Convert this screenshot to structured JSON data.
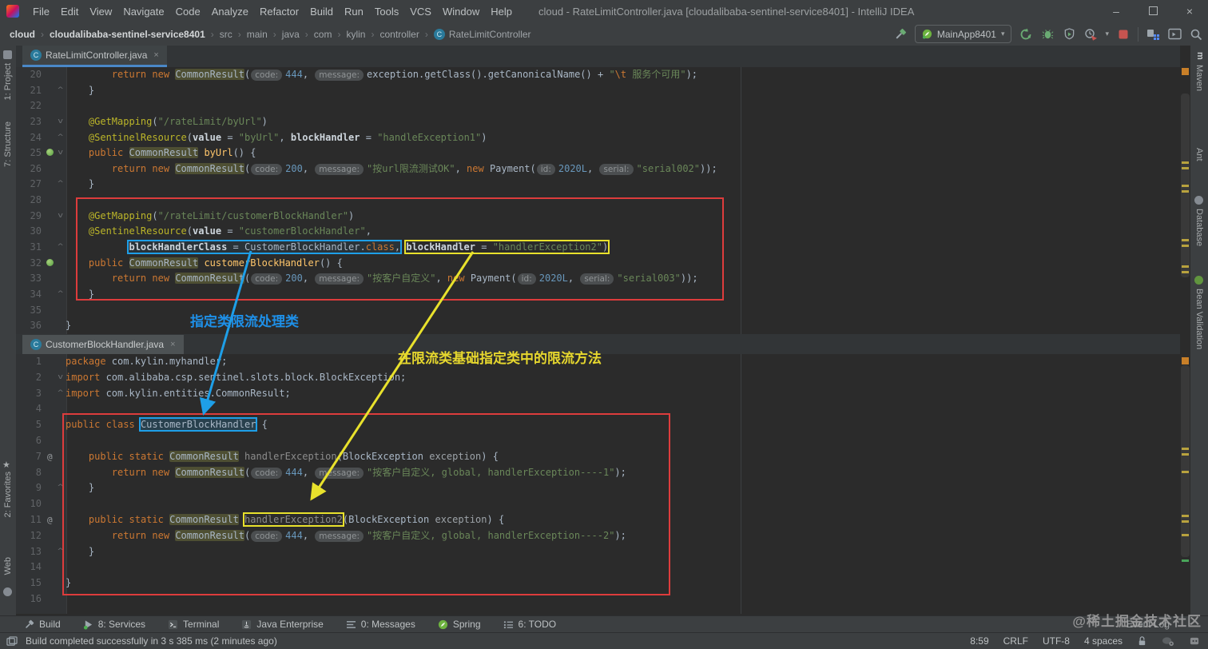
{
  "title_bar": {
    "menus": [
      "File",
      "Edit",
      "View",
      "Navigate",
      "Code",
      "Analyze",
      "Refactor",
      "Build",
      "Run",
      "Tools",
      "VCS",
      "Window",
      "Help"
    ],
    "title": "cloud - RateLimitController.java [cloudalibaba-sentinel-service8401] - IntelliJ IDEA",
    "controls": {
      "minimize": "–",
      "close": "×"
    }
  },
  "ui": {
    "close_glyph": "×",
    "crumb_separator": "›",
    "caret_down": "▾",
    "class_icon_letter": "C"
  },
  "toolbar": {
    "breadcrumbs": [
      {
        "label": "cloud",
        "bold": true
      },
      {
        "label": "cloudalibaba-sentinel-service8401",
        "bold": true
      },
      {
        "label": "src",
        "bold": false
      },
      {
        "label": "main",
        "bold": false
      },
      {
        "label": "java",
        "bold": false
      },
      {
        "label": "com",
        "bold": false
      },
      {
        "label": "kylin",
        "bold": false
      },
      {
        "label": "controller",
        "bold": false
      },
      {
        "label": "RateLimitController",
        "bold": false
      }
    ],
    "run_config": "MainApp8401"
  },
  "left_bar": {
    "items": [
      "1: Project",
      "7: Structure",
      "2: Favorites",
      "Web"
    ]
  },
  "right_bar": {
    "items": [
      "Maven",
      "Ant",
      "Database",
      "Bean Validation"
    ]
  },
  "overlay_notes": {
    "blue": "指定类限流处理类",
    "yellow": "在限流类基础指定类中的限流方法"
  },
  "colors": {
    "editor_bg": "#2b2b2b",
    "chrome_bg": "#3c3f41",
    "red_box": "#dd3c3c",
    "blue_annotation": "#1e9fe8",
    "yellow_annotation": "#e8e12c",
    "tab_underline": "#4a88c7",
    "keyword": "#cc7832",
    "string": "#6a8759",
    "number": "#6897bb"
  },
  "editors": [
    {
      "tab": "RateLimitController.java",
      "lines": [
        {
          "n": 20,
          "s": [
            [
              "def",
              "        "
            ],
            [
              "kw",
              "return"
            ],
            [
              "def",
              " "
            ],
            [
              "kw",
              "new"
            ],
            [
              "def",
              " "
            ],
            [
              "hl",
              "CommonResult"
            ],
            [
              "def",
              "("
            ],
            [
              "hint",
              "code:"
            ],
            [
              "num",
              "444"
            ],
            [
              "def",
              ", "
            ],
            [
              "hint",
              "message:"
            ],
            [
              "def",
              "exception.getClass().getCanonicalName() + "
            ],
            [
              "str",
              "\""
            ],
            [
              "esc",
              "\\t"
            ],
            [
              "str",
              " 服务个可用\""
            ],
            [
              "def",
              ");"
            ]
          ]
        },
        {
          "n": 21,
          "ic": [
            "up"
          ],
          "s": [
            [
              "def",
              "    }"
            ]
          ]
        },
        {
          "n": 22,
          "s": []
        },
        {
          "n": 23,
          "ic": [
            "down"
          ],
          "s": [
            [
              "def",
              "    "
            ],
            [
              "ann",
              "@GetMapping"
            ],
            [
              "def",
              "("
            ],
            [
              "str",
              "\"/rateLimit/byUrl\""
            ],
            [
              "def",
              ")"
            ]
          ]
        },
        {
          "n": 24,
          "ic": [
            "up"
          ],
          "s": [
            [
              "def",
              "    "
            ],
            [
              "ann",
              "@SentinelResource"
            ],
            [
              "def",
              "("
            ],
            [
              "atr",
              "value"
            ],
            [
              "def",
              " = "
            ],
            [
              "str",
              "\"byUrl\""
            ],
            [
              "def",
              ", "
            ],
            [
              "atr",
              "blockHandler"
            ],
            [
              "def",
              " = "
            ],
            [
              "str",
              "\"handleException1\""
            ],
            [
              "def",
              ")"
            ]
          ]
        },
        {
          "n": 25,
          "ic": [
            "bean",
            "down"
          ],
          "s": [
            [
              "def",
              "    "
            ],
            [
              "kw",
              "public"
            ],
            [
              "def",
              " "
            ],
            [
              "hl",
              "CommonResult"
            ],
            [
              "def",
              " "
            ],
            [
              "mth",
              "byUrl"
            ],
            [
              "def",
              "() {"
            ]
          ]
        },
        {
          "n": 26,
          "s": [
            [
              "def",
              "        "
            ],
            [
              "kw",
              "return"
            ],
            [
              "def",
              " "
            ],
            [
              "kw",
              "new"
            ],
            [
              "def",
              " "
            ],
            [
              "hl",
              "CommonResult"
            ],
            [
              "def",
              "("
            ],
            [
              "hint",
              "code:"
            ],
            [
              "num",
              "200"
            ],
            [
              "def",
              ", "
            ],
            [
              "hint",
              "message:"
            ],
            [
              "str",
              "\"按url限流测试OK\""
            ],
            [
              "def",
              ", "
            ],
            [
              "kw",
              "new"
            ],
            [
              "def",
              " Payment("
            ],
            [
              "hint",
              "id:"
            ],
            [
              "num",
              "2020L"
            ],
            [
              "def",
              ", "
            ],
            [
              "hint",
              "serial:"
            ],
            [
              "str",
              "\"serial002\""
            ],
            [
              "def",
              "));"
            ]
          ]
        },
        {
          "n": 27,
          "ic": [
            "up"
          ],
          "s": [
            [
              "def",
              "    }"
            ]
          ]
        },
        {
          "n": 28,
          "s": []
        },
        {
          "n": 29,
          "ic": [
            "down"
          ],
          "s": [
            [
              "def",
              "    "
            ],
            [
              "ann",
              "@GetMapping"
            ],
            [
              "def",
              "("
            ],
            [
              "str",
              "\"/rateLimit/customerBlockHandler\""
            ],
            [
              "def",
              ")"
            ]
          ]
        },
        {
          "n": 30,
          "s": [
            [
              "def",
              "    "
            ],
            [
              "ann",
              "@SentinelResource"
            ],
            [
              "def",
              "("
            ],
            [
              "atr",
              "value"
            ],
            [
              "def",
              " = "
            ],
            [
              "str",
              "\"customerBlockHandler\""
            ],
            [
              "def",
              ","
            ]
          ]
        },
        {
          "n": 31,
          "ic": [
            "up"
          ],
          "s": [
            [
              "def",
              "           "
            ],
            [
              "box",
              "blue",
              [
                [
                  "atr",
                  "blockHandlerClass"
                ],
                [
                  "def",
                  " = "
                ],
                [
                  "def",
                  "CustomerBlockHandler."
                ],
                [
                  "kw",
                  "class"
                ],
                [
                  "def",
                  ","
                ]
              ]
            ],
            [
              "def",
              " "
            ],
            [
              "box",
              "yellow",
              [
                [
                  "atr",
                  "blockHandler"
                ],
                [
                  "def",
                  " = "
                ],
                [
                  "str",
                  "\"handlerException2\""
                ],
                [
                  "def",
                  ")"
                ]
              ]
            ]
          ]
        },
        {
          "n": 32,
          "ic": [
            "bean"
          ],
          "s": [
            [
              "def",
              "    "
            ],
            [
              "kw",
              "public"
            ],
            [
              "def",
              " "
            ],
            [
              "hl",
              "CommonResult"
            ],
            [
              "def",
              " "
            ],
            [
              "mth",
              "customerBlockHandler"
            ],
            [
              "def",
              "() {"
            ]
          ]
        },
        {
          "n": 33,
          "s": [
            [
              "def",
              "        "
            ],
            [
              "kw",
              "return"
            ],
            [
              "def",
              " "
            ],
            [
              "kw",
              "new"
            ],
            [
              "def",
              " "
            ],
            [
              "hl",
              "CommonResult"
            ],
            [
              "def",
              "("
            ],
            [
              "hint",
              "code:"
            ],
            [
              "num",
              "200"
            ],
            [
              "def",
              ", "
            ],
            [
              "hint",
              "message:"
            ],
            [
              "str",
              "\"按客户自定义\""
            ],
            [
              "def",
              ", "
            ],
            [
              "kw",
              "new"
            ],
            [
              "def",
              " Payment("
            ],
            [
              "hint",
              "id:"
            ],
            [
              "num",
              "2020L"
            ],
            [
              "def",
              ", "
            ],
            [
              "hint",
              "serial:"
            ],
            [
              "str",
              "\"serial003\""
            ],
            [
              "def",
              "));"
            ]
          ]
        },
        {
          "n": 34,
          "ic": [
            "up"
          ],
          "s": [
            [
              "def",
              "    }"
            ]
          ]
        },
        {
          "n": 35,
          "s": []
        },
        {
          "n": 36,
          "s": [
            [
              "def",
              "}"
            ]
          ]
        }
      ]
    },
    {
      "tab": "CustomerBlockHandler.java",
      "lines": [
        {
          "n": 1,
          "s": [
            [
              "kw",
              "package"
            ],
            [
              "def",
              " com.kylin.myhandler;"
            ]
          ]
        },
        {
          "n": 2,
          "ic": [
            "down"
          ],
          "s": [
            [
              "kw",
              "import"
            ],
            [
              "def",
              " com.alibaba.csp.sentinel.slots.block.BlockException;"
            ]
          ]
        },
        {
          "n": 3,
          "ic": [
            "up"
          ],
          "s": [
            [
              "kw",
              "import"
            ],
            [
              "def",
              " com.kylin.entities.CommonResult;"
            ]
          ]
        },
        {
          "n": 4,
          "s": []
        },
        {
          "n": 5,
          "s": [
            [
              "kw",
              "public"
            ],
            [
              "def",
              " "
            ],
            [
              "kw",
              "class"
            ],
            [
              "def",
              " "
            ],
            [
              "box",
              "blue2",
              [
                [
                  "def",
                  "CustomerBlockHandler"
                ]
              ]
            ],
            [
              "def",
              " {"
            ]
          ]
        },
        {
          "n": 6,
          "s": []
        },
        {
          "n": 7,
          "ic": [
            "at"
          ],
          "s": [
            [
              "def",
              "    "
            ],
            [
              "kw",
              "public"
            ],
            [
              "def",
              " "
            ],
            [
              "kw",
              "static"
            ],
            [
              "def",
              " "
            ],
            [
              "hl",
              "CommonResult"
            ],
            [
              "def",
              " "
            ],
            [
              "gray",
              "handlerException"
            ],
            [
              "def",
              "("
            ],
            [
              "def",
              "BlockException "
            ],
            [
              "prm",
              "exception"
            ],
            [
              "def",
              ") {"
            ]
          ]
        },
        {
          "n": 8,
          "s": [
            [
              "def",
              "        "
            ],
            [
              "kw",
              "return"
            ],
            [
              "def",
              " "
            ],
            [
              "kw",
              "new"
            ],
            [
              "def",
              " "
            ],
            [
              "hl",
              "CommonResult"
            ],
            [
              "def",
              "("
            ],
            [
              "hint",
              "code:"
            ],
            [
              "num",
              "444"
            ],
            [
              "def",
              ", "
            ],
            [
              "hint",
              "message:"
            ],
            [
              "str",
              "\"按客户自定义, global, handlerException----1\""
            ],
            [
              "def",
              ");"
            ]
          ]
        },
        {
          "n": 9,
          "ic": [
            "up"
          ],
          "s": [
            [
              "def",
              "    }"
            ]
          ]
        },
        {
          "n": 10,
          "s": []
        },
        {
          "n": 11,
          "ic": [
            "at"
          ],
          "s": [
            [
              "def",
              "    "
            ],
            [
              "kw",
              "public"
            ],
            [
              "def",
              " "
            ],
            [
              "kw",
              "static"
            ],
            [
              "def",
              " "
            ],
            [
              "hl",
              "CommonResult"
            ],
            [
              "def",
              " "
            ],
            [
              "box",
              "yellow2",
              [
                [
                  "gray",
                  "handlerException2"
                ]
              ]
            ],
            [
              "def",
              "("
            ],
            [
              "def",
              "BlockException "
            ],
            [
              "prm",
              "exception"
            ],
            [
              "def",
              ") {"
            ]
          ]
        },
        {
          "n": 12,
          "s": [
            [
              "def",
              "        "
            ],
            [
              "kw",
              "return"
            ],
            [
              "def",
              " "
            ],
            [
              "kw",
              "new"
            ],
            [
              "def",
              " "
            ],
            [
              "hl",
              "CommonResult"
            ],
            [
              "def",
              "("
            ],
            [
              "hint",
              "code:"
            ],
            [
              "num",
              "444"
            ],
            [
              "def",
              ", "
            ],
            [
              "hint",
              "message:"
            ],
            [
              "str",
              "\"按客户自定义, global, handlerException----2\""
            ],
            [
              "def",
              ");"
            ]
          ]
        },
        {
          "n": 13,
          "ic": [
            "up"
          ],
          "s": [
            [
              "def",
              "    }"
            ]
          ]
        },
        {
          "n": 14,
          "s": []
        },
        {
          "n": 15,
          "s": [
            [
              "def",
              "}"
            ]
          ]
        },
        {
          "n": 16,
          "s": []
        }
      ]
    }
  ],
  "bottom_bar": {
    "items": [
      "Build",
      "8: Services",
      "Terminal",
      "Java Enterprise",
      "0: Messages",
      "Spring",
      "6: TODO"
    ],
    "event_log": "Event Log",
    "watermark": "@稀土掘金技术社区"
  },
  "status_bar": {
    "message": "Build completed successfully in 3 s 385 ms (2 minutes ago)",
    "caret": "8:59",
    "line_ending": "CRLF",
    "encoding": "UTF-8",
    "indent": "4 spaces"
  }
}
